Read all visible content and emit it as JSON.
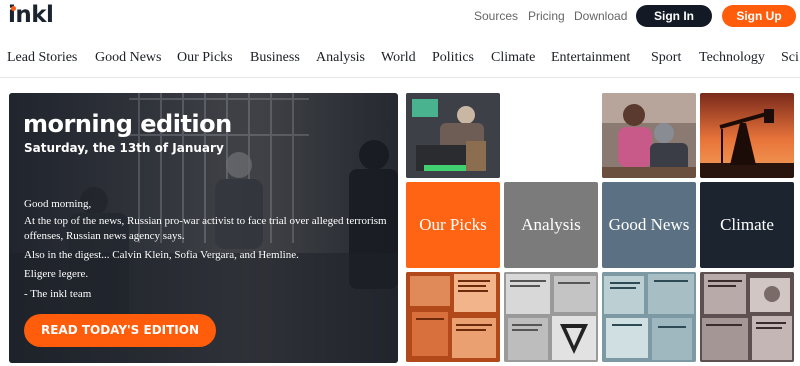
{
  "header": {
    "logo": "inkl",
    "links": [
      "Sources",
      "Pricing",
      "Download"
    ],
    "sign_in": "Sign In",
    "sign_up": "Sign Up"
  },
  "nav": {
    "items": [
      "Lead Stories",
      "Good News",
      "Our Picks",
      "Business",
      "Analysis",
      "World",
      "Politics",
      "Climate",
      "Entertainment",
      "Sport",
      "Technology",
      "Sci"
    ]
  },
  "hero": {
    "title": "morning edition",
    "date": "Saturday, the 13th of January",
    "paragraphs": [
      "Good morning,",
      "At the top of the news, Russian pro-war activist to face trial over alleged terrorism offenses, Russian news agency says.",
      "Also in the digest... Calvin Klein, Sofia Vergara, and Hemline.",
      "Eligere legere.",
      "- The inkl team"
    ],
    "cta": "READ TODAY'S EDITION"
  },
  "tiles": [
    {
      "label": "Our Picks",
      "color": "#ff6414"
    },
    {
      "label": "Analysis",
      "color": "#7b7b7b"
    },
    {
      "label": "Good News",
      "color": "#5b7183"
    },
    {
      "label": "Climate",
      "color": "#1c2430"
    }
  ],
  "colors": {
    "accent": "#ff5c0b",
    "dark": "#131a26"
  }
}
